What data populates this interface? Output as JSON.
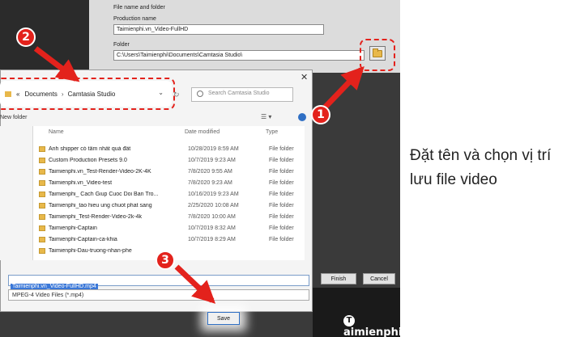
{
  "wizard": {
    "section_label": "File name and folder",
    "production_label": "Production name",
    "production_value": "Taimienphi.vn_Video-FullHD",
    "folder_label": "Folder",
    "folder_value": "C:\\Users\\Taimienphi\\Documents\\Camtasia Studio\\",
    "finish_label": "Finish",
    "cancel_label": "Cancel"
  },
  "dialog": {
    "breadcrumb": [
      "Documents",
      "Camtasia Studio"
    ],
    "breadcrumb_prefix": "«",
    "search_placeholder": "Search Camtasia Studio",
    "new_folder_label": "New folder",
    "columns": {
      "name": "Name",
      "date": "Date modified",
      "type": "Type"
    },
    "files": [
      {
        "name": "Anh shipper có tâm nhất quả đất",
        "date": "10/28/2019 8:59 AM",
        "type": "File folder"
      },
      {
        "name": "Custom Production Presets 9.0",
        "date": "10/7/2019 9:23 AM",
        "type": "File folder"
      },
      {
        "name": "Taimienphi.vn_Test-Render-Video-2K-4K",
        "date": "7/8/2020 9:55 AM",
        "type": "File folder"
      },
      {
        "name": "Taimienphi.vn_Video-test",
        "date": "7/8/2020 9:23 AM",
        "type": "File folder"
      },
      {
        "name": "Taimienphi_ Cach Giup Cuoc Doi Ban Tro...",
        "date": "10/16/2019 9:23 AM",
        "type": "File folder"
      },
      {
        "name": "Taimienphi_tao hieu ung chuot phat sang",
        "date": "2/25/2020 10:08 AM",
        "type": "File folder"
      },
      {
        "name": "Taimienphi_Test-Render-Video-2k-4k",
        "date": "7/8/2020 10:00 AM",
        "type": "File folder"
      },
      {
        "name": "Taimienphi-Captain",
        "date": "10/7/2019 8:32 AM",
        "type": "File folder"
      },
      {
        "name": "Taimienphi-Captain-ca-khia",
        "date": "10/7/2019 8:29 AM",
        "type": "File folder"
      },
      {
        "name": "Taimienphi-Dau-truong-nhan-phe",
        "date": "",
        "type": ""
      }
    ],
    "filename_value": "Taimienphi.vn_Video-FullHD.mp4",
    "filetype_value": "MPEG-4 Video Files (*.mp4)",
    "save_label": "Save"
  },
  "steps": [
    "1",
    "2",
    "3"
  ],
  "brand": "aimienphi",
  "brand_initial": "T",
  "caption": "Đặt tên và chọn vị trí lưu file video",
  "colors": {
    "accent_red": "#e3221c",
    "selection_blue": "#3b78d8",
    "folder_yellow": "#e8b84a"
  }
}
